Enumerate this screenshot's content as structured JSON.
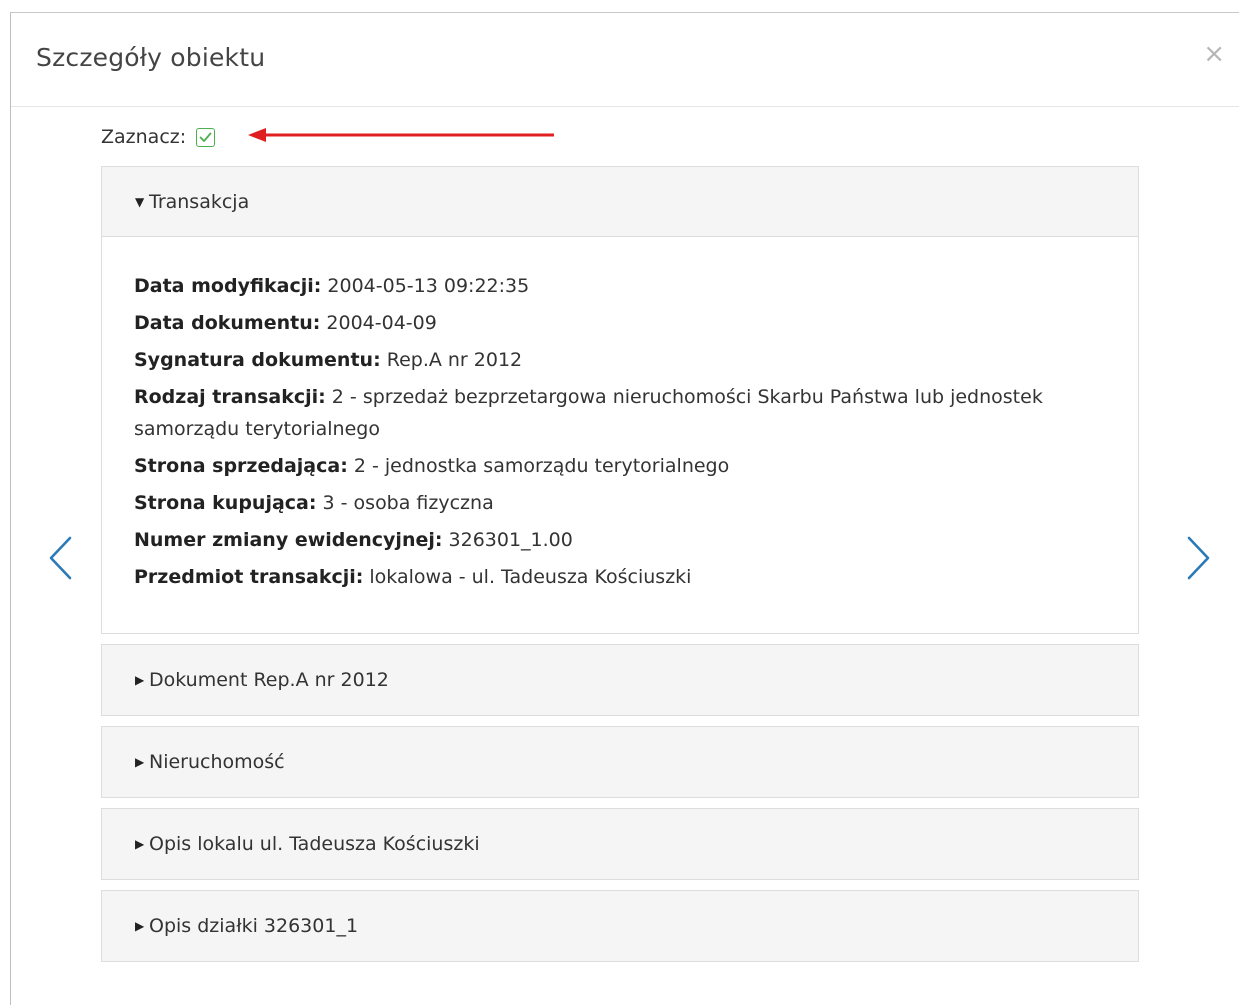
{
  "modal": {
    "title": "Szczegóły obiektu",
    "close_label": "×"
  },
  "select": {
    "label": "Zaznacz:",
    "checked": true
  },
  "annotation": {
    "arrow_color": "#e02020"
  },
  "panels": [
    {
      "title": "Transakcja",
      "expanded": true,
      "fields": [
        {
          "label": "Data modyfikacji:",
          "value": "2004-05-13 09:22:35"
        },
        {
          "label": "Data dokumentu:",
          "value": "2004-04-09"
        },
        {
          "label": "Sygnatura dokumentu:",
          "value": "Rep.A nr 2012"
        },
        {
          "label": "Rodzaj transakcji:",
          "value": "2 - sprzedaż bezprzetargowa nieruchomości Skarbu Państwa lub jednostek samorządu terytorialnego"
        },
        {
          "label": "Strona sprzedająca:",
          "value": "2 - jednostka samorządu terytorialnego"
        },
        {
          "label": "Strona kupująca:",
          "value": "3 - osoba fizyczna"
        },
        {
          "label": "Numer zmiany ewidencyjnej:",
          "value": "326301_1.00"
        },
        {
          "label": "Przedmiot transakcji:",
          "value": "lokalowa - ul. Tadeusza Kościuszki"
        }
      ]
    },
    {
      "title": "Dokument Rep.A nr 2012",
      "expanded": false
    },
    {
      "title": "Nieruchomość",
      "expanded": false
    },
    {
      "title": "Opis lokalu ul. Tadeusza Kościuszki",
      "expanded": false
    },
    {
      "title": "Opis działki 326301_1",
      "expanded": false
    }
  ],
  "colors": {
    "nav_arrow": "#2a7ab8",
    "checkbox": "#4caf50",
    "panel_bg": "#f5f5f5"
  },
  "icons": {
    "prev": "chevron-left-icon",
    "next": "chevron-right-icon",
    "expanded": "caret-down-icon",
    "collapsed": "caret-right-icon"
  }
}
